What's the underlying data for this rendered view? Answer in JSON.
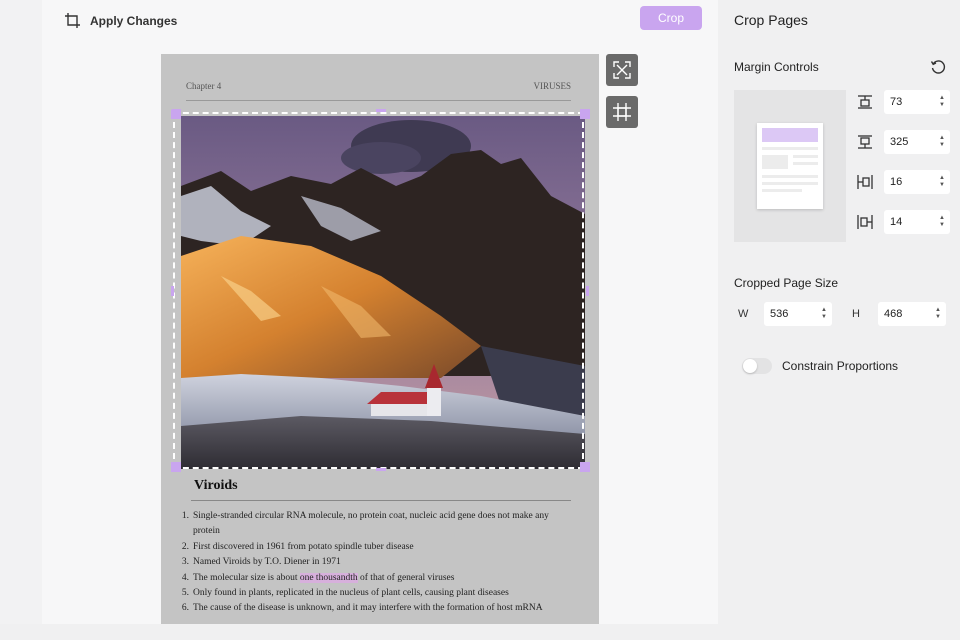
{
  "toolbar": {
    "apply_label": "Apply Changes",
    "crop_label": "Crop"
  },
  "document": {
    "header_left": "Chapter 4",
    "header_right": "VIRUSES",
    "section_title": "Viroids",
    "list": [
      {
        "num": "1.",
        "text": "Single-stranded circular RNA molecule, no protein coat, nucleic acid gene does not make any protein"
      },
      {
        "num": "2.",
        "text": "First discovered in 1961 from potato spindle tuber disease"
      },
      {
        "num": "3.",
        "text": "Named Viroids by T.O. Diener in 1971"
      },
      {
        "num": "4.",
        "pre": "The molecular size is about ",
        "hl": "one thousandth",
        "post": " of that of general viruses"
      },
      {
        "num": "5.",
        "text": "Only found in plants, replicated in the nucleus of plant cells, causing plant diseases"
      },
      {
        "num": "6.",
        "text": "The cause of the disease is unknown, and it may interfere with the formation of host mRNA"
      }
    ]
  },
  "sidebar": {
    "title": "Crop Pages",
    "margin_title": "Margin Controls",
    "margins": {
      "top": "73",
      "bottom": "325",
      "left": "16",
      "right": "14"
    },
    "size_title": "Cropped Page Size",
    "width_label": "W",
    "width_value": "536",
    "height_label": "H",
    "height_value": "468",
    "constrain_label": "Constrain Proportions",
    "constrain_on": false
  },
  "colors": {
    "accent": "#c9a5ef",
    "page_bg": "#c4c4c4",
    "highlight": "#d7b0dc"
  },
  "icons": [
    "crop-icon",
    "fit-page-icon",
    "fit-content-icon",
    "reset-icon",
    "margin-top-icon",
    "margin-bottom-icon",
    "margin-left-icon",
    "margin-right-icon"
  ]
}
